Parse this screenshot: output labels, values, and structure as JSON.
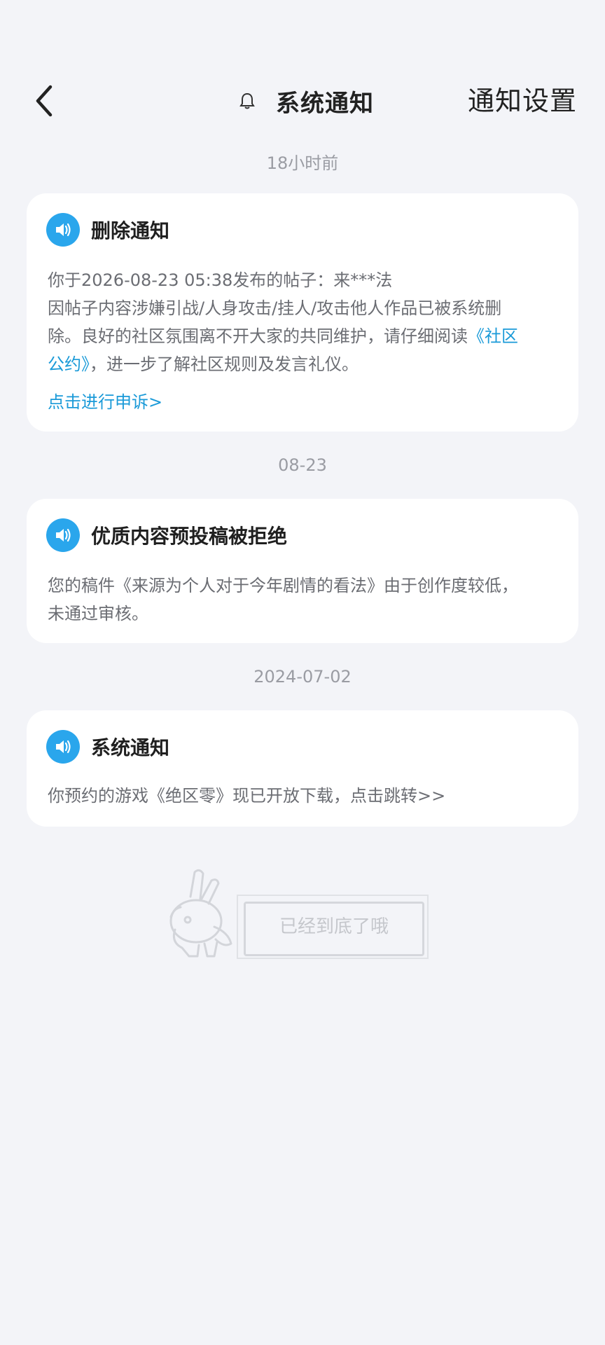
{
  "header": {
    "title": "系统通知",
    "settings_label": "通知设置"
  },
  "groups": [
    {
      "time": "18小时前",
      "card": {
        "title": "删除通知",
        "line1": "你于2026-08-23 05:38发布的帖子：来***法",
        "line2": "因帖子内容涉嫌引战/人身攻击/挂人/攻击他人作品已被系统删",
        "line3_prefix": "除。良好的社区氛围离不开大家的共同维护，请仔细阅读",
        "line3_link": "《社区",
        "line4_link": "公约》",
        "line4_suffix": "，进一步了解社区规则及发言礼仪。",
        "appeal": "点击进行申诉>"
      }
    },
    {
      "time": "08-23",
      "card": {
        "title": "优质内容预投稿被拒绝",
        "line1": "您的稿件《来源为个人对于今年剧情的看法》由于创作度较低，",
        "line2": "未通过审核。"
      }
    },
    {
      "time": "2024-07-02",
      "card": {
        "title": "系统通知",
        "line1": "你预约的游戏《绝区零》现已开放下载，点击跳转>>"
      }
    }
  ],
  "footer": {
    "end_text": "已经到底了哦"
  },
  "colors": {
    "background": "#f3f4f8",
    "accent": "#2aa6ec",
    "link": "#1a9ad8"
  }
}
